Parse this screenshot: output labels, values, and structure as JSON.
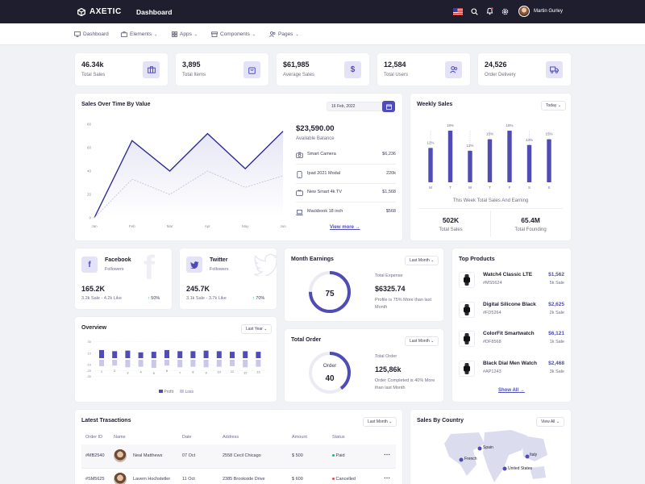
{
  "topbar": {
    "brand": "AXETIC",
    "title": "Dashboard",
    "user": "Martin Gurley"
  },
  "menu": [
    {
      "label": "Dashboard",
      "icon": "monitor-icon"
    },
    {
      "label": "Elements",
      "icon": "briefcase-icon"
    },
    {
      "label": "Apps",
      "icon": "grid-icon"
    },
    {
      "label": "Components",
      "icon": "box-icon"
    },
    {
      "label": "Pages",
      "icon": "users-icon"
    }
  ],
  "stats": [
    {
      "value": "46.34k",
      "label": "Total Sales",
      "icon": "briefcase-icon"
    },
    {
      "value": "3,895",
      "label": "Total Items",
      "icon": "bag-icon"
    },
    {
      "value": "$61,985",
      "label": "Average Sales",
      "icon": "dollar-icon"
    },
    {
      "value": "12,584",
      "label": "Total Users",
      "icon": "users-icon"
    },
    {
      "value": "24,526",
      "label": "Order Delivery",
      "icon": "truck-icon"
    }
  ],
  "sales_over_time": {
    "title": "Sales Over Time By Value",
    "date": "16 Feb, 2022",
    "balance": "$23,590.00",
    "balance_label": "Available Balance",
    "items": [
      {
        "name": "Smart Camera",
        "value": "$6,236",
        "icon": "camera-icon"
      },
      {
        "name": "Ipad 2021 Modal",
        "value": "220k",
        "icon": "tablet-icon"
      },
      {
        "name": "New Smart 4k TV",
        "value": "$1,568",
        "icon": "tv-icon"
      },
      {
        "name": "Mackbook 18 inch",
        "value": "$568",
        "icon": "laptop-icon"
      }
    ],
    "view_more": "View more"
  },
  "weekly_sales": {
    "title": "Weekly Sales",
    "filter": "Today",
    "caption": "This Week Total Sales And Earning",
    "sales_value": "502K",
    "sales_label": "Total Sales",
    "founding_value": "65.4M",
    "founding_label": "Total Founding"
  },
  "facebook": {
    "name": "Facebook",
    "sub": "Followers",
    "value": "165.2K",
    "detail": "3.2k Sale - 4.2k Like",
    "pct": "50%"
  },
  "twitter": {
    "name": "Twitter",
    "sub": "Followers",
    "value": "245.7K",
    "detail": "3.1k Sale - 3.7k Like",
    "pct": "70%"
  },
  "month_earnings": {
    "title": "Month Earnings",
    "filter": "Last Month",
    "gauge": "75",
    "gauge_pct": 0.75,
    "label": "Total Expense",
    "value": "$6325.74",
    "note": "Profile is 75% More than last Month"
  },
  "total_order": {
    "title": "Total Order",
    "filter": "Last Month",
    "gauge_label": "Order",
    "gauge": "40",
    "gauge_pct": 0.4,
    "label": "Total Order",
    "value": "125,86k",
    "note": "Order Completed is 40% More than last Month"
  },
  "top_products": {
    "title": "Top Products",
    "show_all": "Show All",
    "items": [
      {
        "name": "Watch4 Classic LTE",
        "code": "#MS5624",
        "price": "$1,562",
        "sale": "5k Sale"
      },
      {
        "name": "Digital Silicone Black",
        "code": "#FD5264",
        "price": "$2,625",
        "sale": "2k Sale"
      },
      {
        "name": "ColorFit Smartwatch",
        "code": "#DF8568",
        "price": "$6,121",
        "sale": "1k Sale"
      },
      {
        "name": "Black Dial Men Watch",
        "code": "#AP1243",
        "price": "$2,468",
        "sale": "3k Sale"
      }
    ]
  },
  "overview": {
    "title": "Overview",
    "filter": "Last Year",
    "legend": [
      "Profit",
      "Loss"
    ]
  },
  "transactions": {
    "title": "Latest Trasactions",
    "filter": "Last Month",
    "headers": [
      "Order ID",
      "Name",
      "Date",
      "Address",
      "Amount",
      "Status"
    ],
    "rows": [
      {
        "id": "#MB2540",
        "name": "Neal Matthews",
        "date": "07 Oct",
        "address": "2558 Cecil Chicago",
        "amount": "$ 500",
        "status": "Paid",
        "status_color": "#22b573"
      },
      {
        "id": "#SM5625",
        "name": "Lavern Hochstetler",
        "date": "11 Oct",
        "address": "2385 Brookside Drive",
        "amount": "$ 600",
        "status": "Cancelled",
        "status_color": "#f24b4b"
      }
    ]
  },
  "sales_country": {
    "title": "Sales By Country",
    "filter": "View All",
    "labels": [
      "Spain",
      "French",
      "Italy",
      "United States"
    ]
  },
  "colors": {
    "accent": "#4f4cb5",
    "dark": "#1f1e2e",
    "success": "#22b573",
    "danger": "#f24b4b"
  },
  "chart_data": [
    {
      "type": "line",
      "title": "Sales Over Time By Value",
      "categories": [
        "Jan",
        "Feb",
        "Mar",
        "Apr",
        "May",
        "Jun"
      ],
      "series": [
        {
          "values": [
            0,
            66,
            40,
            72,
            42,
            74
          ]
        },
        {
          "values": [
            0,
            33,
            20,
            40,
            26,
            36
          ]
        }
      ],
      "ylim": [
        0,
        80
      ],
      "yticks": [
        0,
        20,
        40,
        60,
        80
      ]
    },
    {
      "type": "bar",
      "title": "Weekly Sales",
      "categories": [
        "M",
        "T",
        "W",
        "T",
        "F",
        "S",
        "S"
      ],
      "values": [
        12,
        18,
        11,
        15,
        18,
        13,
        15
      ],
      "labels": [
        "12%",
        "18%",
        "11%",
        "15%",
        "18%",
        "13%",
        "15%"
      ]
    },
    {
      "type": "bar",
      "title": "Overview",
      "categories": [
        "1",
        "2",
        "3",
        "4",
        "5",
        "6",
        "7",
        "8",
        "9",
        "10",
        "11",
        "12",
        "13"
      ],
      "series": [
        {
          "name": "Profit",
          "values": [
            14,
            12,
            13,
            10,
            11,
            14,
            12,
            12,
            13,
            12,
            11,
            12,
            11
          ]
        },
        {
          "name": "Loss",
          "values": [
            -11,
            -10,
            -13,
            -12,
            -14,
            -10,
            -13,
            -12,
            -13,
            -12,
            -11,
            -13,
            -12
          ]
        }
      ],
      "ylim": [
        -30,
        30
      ],
      "yticks": [
        30,
        10,
        -10,
        -20,
        -30
      ]
    }
  ]
}
